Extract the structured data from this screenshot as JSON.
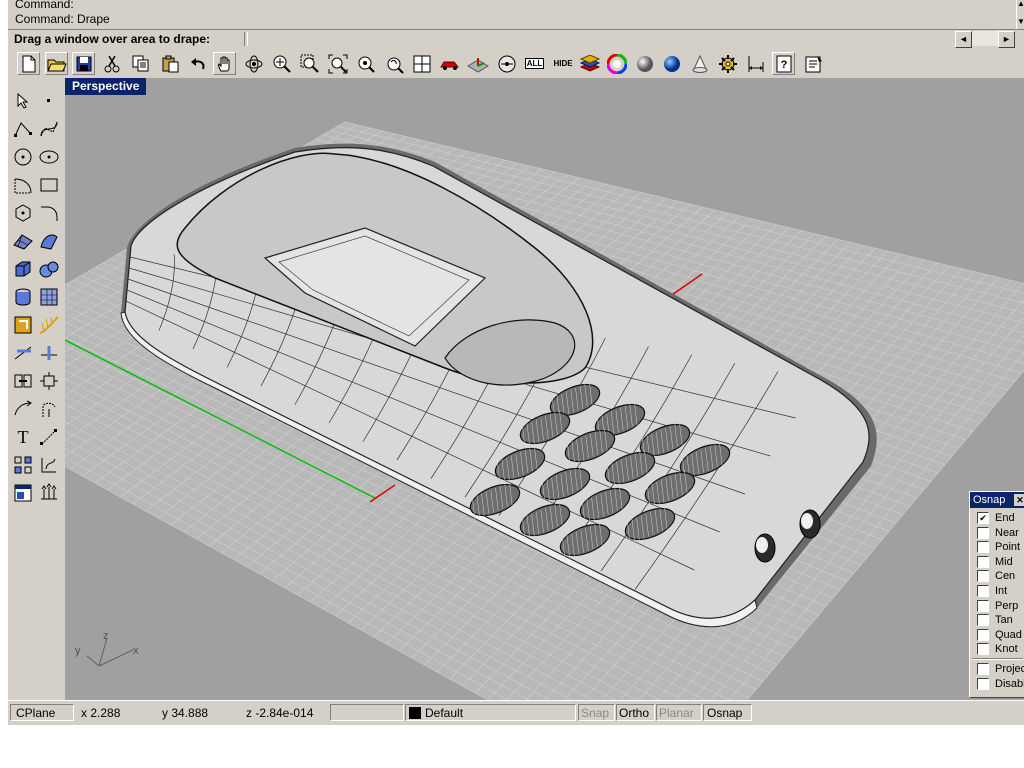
{
  "command_history": [
    "Command:",
    "Command: Drape"
  ],
  "prompt": "Drag a window over area to drape:",
  "viewport": {
    "title": "Perspective"
  },
  "toolbar_icons": [
    "new-file-icon",
    "open-file-icon",
    "save-icon",
    "cut-icon",
    "copy-icon",
    "paste-icon",
    "undo-icon",
    "pan-hand-icon",
    "rotate-view-icon",
    "zoom-dynamic-icon",
    "zoom-window-icon",
    "zoom-extents-icon",
    "zoom-selected-icon",
    "undo-view-icon",
    "four-viewports-icon",
    "car-object-icon",
    "cplane-icon",
    "show-icon",
    "show-all-icon",
    "hide-icon",
    "layers-icon",
    "color-wheel-icon",
    "shade-icon",
    "render-icon",
    "light-icon",
    "options-gear-icon",
    "dimension-icon",
    "help-icon",
    "properties-icon"
  ],
  "toolbar_text": {
    "all": "ALL",
    "hide": "HIDE"
  },
  "left_tools": {
    "text_tool": "T"
  },
  "osnap": {
    "title": "Osnap",
    "items": [
      {
        "label": "End",
        "checked": true
      },
      {
        "label": "Near",
        "checked": false
      },
      {
        "label": "Point",
        "checked": false
      },
      {
        "label": "Mid",
        "checked": false
      },
      {
        "label": "Cen",
        "checked": false
      },
      {
        "label": "Int",
        "checked": false
      },
      {
        "label": "Perp",
        "checked": false
      },
      {
        "label": "Tan",
        "checked": false
      },
      {
        "label": "Quad",
        "checked": false
      },
      {
        "label": "Knot",
        "checked": false
      }
    ],
    "extra": [
      {
        "label": "Project",
        "checked": false
      },
      {
        "label": "Disable",
        "checked": false
      }
    ]
  },
  "status": {
    "cplane": "CPlane",
    "x": "x 2.288",
    "y": "y 34.888",
    "z": "z -2.84e-014",
    "layer": "Default",
    "layer_color": "#000000",
    "snap": "Snap",
    "ortho": "Ortho",
    "planar": "Planar",
    "osnap": "Osnap"
  },
  "axis_labels": {
    "x": "x",
    "y": "y",
    "z": "z"
  },
  "colors": {
    "title_bar": "#0a246a",
    "grid_green": "#00c000",
    "grid_red": "#e00000",
    "panel": "#d4d0c8"
  }
}
